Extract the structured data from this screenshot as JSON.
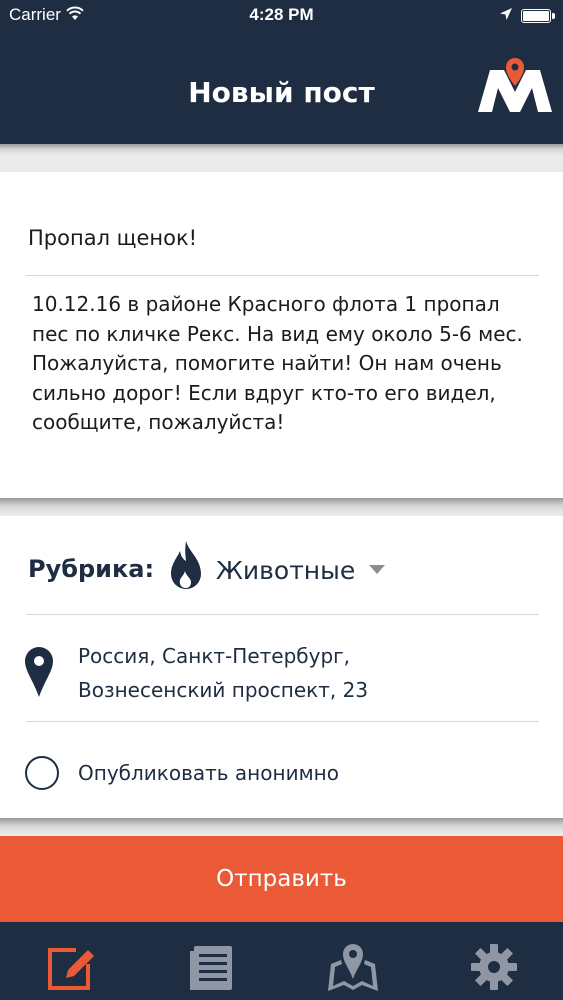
{
  "status_bar": {
    "carrier": "Carrier",
    "time": "4:28 PM",
    "wifi_icon": "wifi-icon",
    "location_icon": "location-arrow-icon",
    "battery_icon": "battery-icon"
  },
  "header": {
    "title": "Новый пост",
    "logo_icon": "m-pin-logo-icon"
  },
  "post": {
    "title": "Пропал щенок!",
    "body": "10.12.16 в районе Красного флота 1 пропал пес по кличке Рекс. На вид ему около 5-6 мес. Пожалуйста, помогите найти! Он нам очень сильно дорог! Если вдруг кто-то его видел, сообщите, пожалуйста!"
  },
  "category": {
    "label": "Рубрика:",
    "value": "Животные",
    "icon": "flame-icon"
  },
  "location": {
    "line1": "Россия, Санкт-Петербург,",
    "line2": "Вознесенский проспект, 23",
    "icon": "map-pin-icon"
  },
  "anonymous": {
    "label": "Опубликовать анонимно",
    "checked": false
  },
  "submit_label": "Отправить",
  "tabs": [
    {
      "icon": "edit-icon",
      "active": true
    },
    {
      "icon": "list-icon",
      "active": false
    },
    {
      "icon": "map-icon",
      "active": false
    },
    {
      "icon": "gear-icon",
      "active": false
    }
  ],
  "colors": {
    "navy": "#1e2d42",
    "accent": "#ea5a37",
    "inactive_tab": "#8e97a3"
  }
}
